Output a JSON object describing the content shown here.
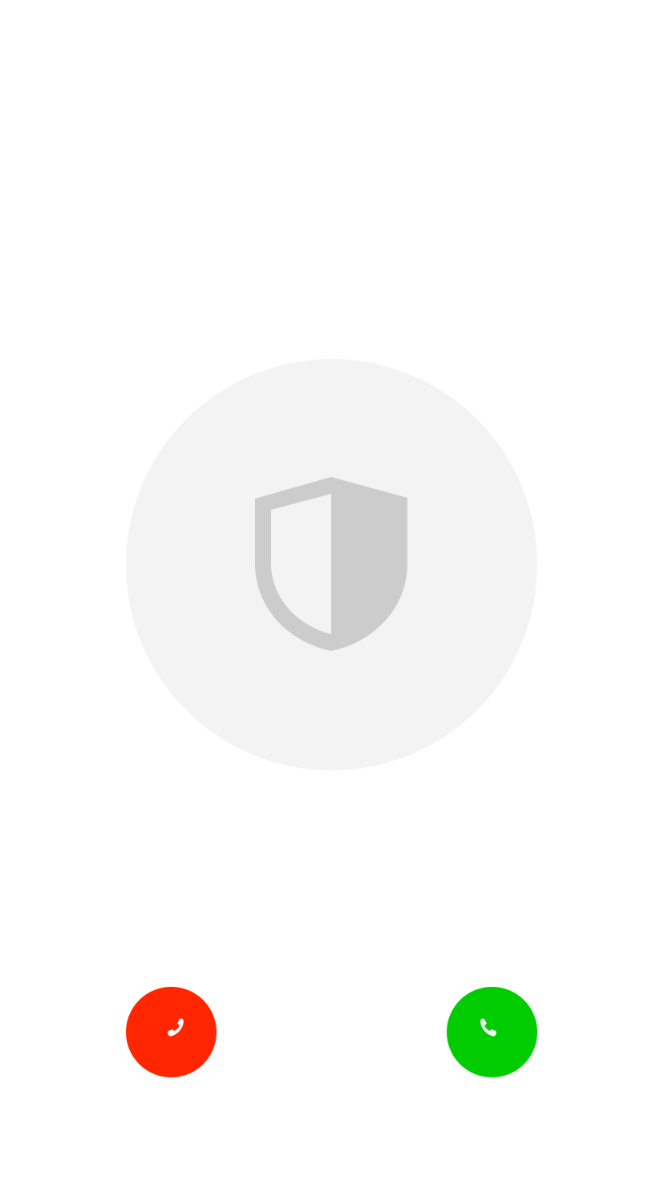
{
  "screen": {
    "background": "#ffffff"
  },
  "caller": {
    "avatar_icon": "shield-icon",
    "avatar_background": "#f3f3f3",
    "icon_color": "#cccccc"
  },
  "actions": {
    "decline": {
      "icon": "phone-hangup-icon",
      "color": "#ff2600"
    },
    "accept": {
      "icon": "phone-icon",
      "color": "#00cc00"
    }
  }
}
